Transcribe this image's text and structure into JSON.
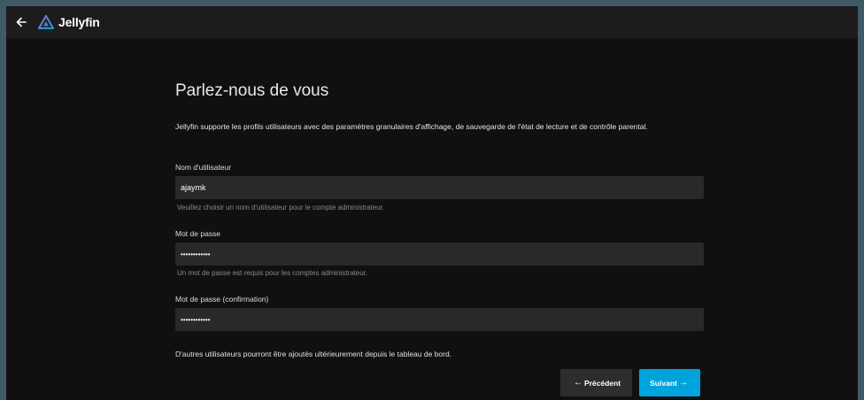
{
  "header": {
    "app_name": "Jellyfin",
    "back_icon": "arrow-left-icon",
    "logo_icon": "jellyfin-logo-icon"
  },
  "form": {
    "title": "Parlez-nous de vous",
    "description": "Jellyfin supporte les profils utilisateurs avec des paramètres granulaires d'affichage, de sauvegarde de l'état de lecture et de contrôle parental.",
    "username": {
      "label": "Nom d'utilisateur",
      "value": "ajaymk",
      "hint": "Veuillez choisir un nom d'utilisateur pour le compte administrateur."
    },
    "password": {
      "label": "Mot de passe",
      "value": "••••••••••••",
      "hint": "Un mot de passe est requis pour les comptes administrateur."
    },
    "password_confirm": {
      "label": "Mot de passe (confirmation)",
      "value": "••••••••••••"
    },
    "note": "D'autres utilisateurs pourront être ajoutés ultérieurement depuis le tableau de bord.",
    "buttons": {
      "previous": "Précédent",
      "next": "Suivant"
    }
  },
  "colors": {
    "accent": "#00a4dc",
    "background": "#101010",
    "header": "#1c1c1c",
    "input": "#292929"
  }
}
